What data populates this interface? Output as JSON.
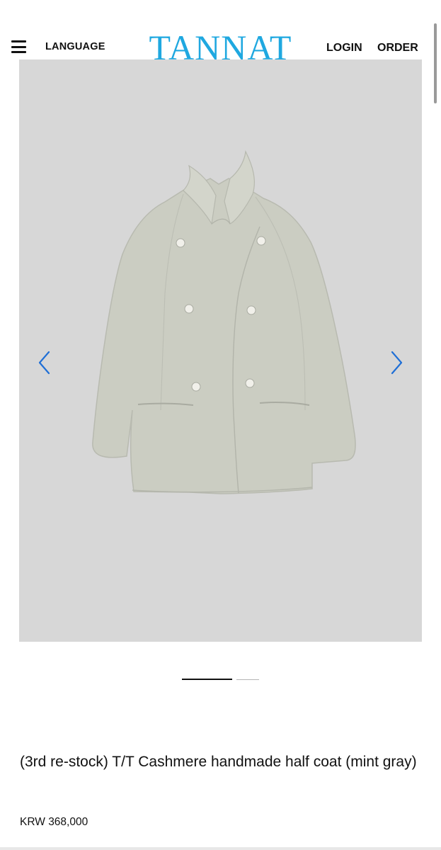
{
  "header": {
    "menu_icon": "hamburger-icon",
    "language_label": "LANGUAGE",
    "logo_text": "TANNAT",
    "login_label": "LOGIN",
    "order_label": "ORDER",
    "brand_color": "#1fa8e0"
  },
  "gallery": {
    "background_color": "#d7d7d7",
    "coat_color": "#cbcdc2",
    "prev_icon": "chevron-left-icon",
    "next_icon": "chevron-right-icon",
    "arrow_color": "#1f6fd6",
    "total_slides": 2,
    "active_slide": 1
  },
  "product": {
    "title": "(3rd re-stock) T/T Cashmere handmade half coat (mint gray)",
    "price": "KRW 368,000"
  }
}
